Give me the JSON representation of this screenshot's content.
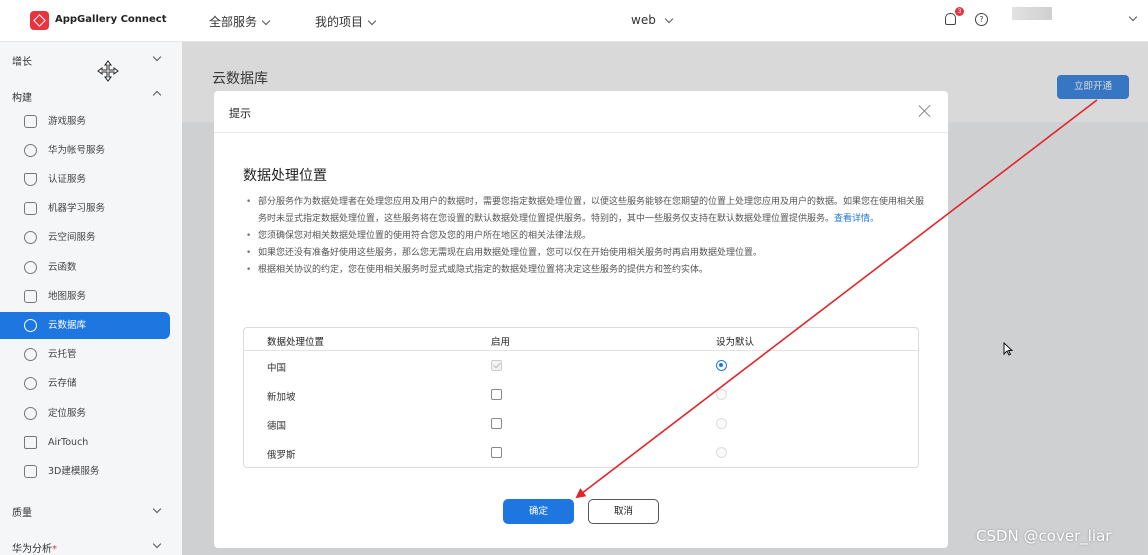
{
  "topbar": {
    "brand": "AppGallery Connect",
    "nav": [
      "全部服务",
      "我的项目"
    ],
    "project": "web",
    "bell_badge": "3",
    "help_glyph": "?"
  },
  "sidebar": {
    "sections": [
      {
        "label": "增长"
      },
      {
        "label": "构建"
      },
      {
        "label": "质量"
      },
      {
        "label": "华为分析"
      }
    ],
    "items": [
      {
        "label": "游戏服务",
        "icon": "game-icon"
      },
      {
        "label": "华为帐号服务",
        "icon": "account-icon"
      },
      {
        "label": "认证服务",
        "icon": "shield-icon"
      },
      {
        "label": "机器学习服务",
        "icon": "robot-icon"
      },
      {
        "label": "云空间服务",
        "icon": "cloud-icon"
      },
      {
        "label": "云函数",
        "icon": "function-icon"
      },
      {
        "label": "地图服务",
        "icon": "map-icon"
      },
      {
        "label": "云数据库",
        "icon": "database-icon",
        "active": true
      },
      {
        "label": "云托管",
        "icon": "hosting-icon"
      },
      {
        "label": "云存储",
        "icon": "storage-icon"
      },
      {
        "label": "定位服务",
        "icon": "location-icon"
      },
      {
        "label": "AirTouch",
        "icon": "touch-icon"
      },
      {
        "label": "3D建模服务",
        "icon": "cube-icon"
      }
    ],
    "new_marker": "*"
  },
  "main": {
    "title": "云数据库",
    "open_button": "立即开通"
  },
  "modal": {
    "title": "提示",
    "heading": "数据处理位置",
    "bullets": [
      "部分服务作为数据处理者在处理您应用及用户的数据时，需要您指定数据处理位置，以便这些服务能够在您期望的位置上处理您应用及用户的数据。如果您在使用相关服务时未显式指定数据处理位置，这些服务将在您设置的默认数据处理位置提供服务。特别的，其中一些服务仅支持在默认数据处理位置提供服务。",
      "您须确保您对相关数据处理位置的使用符合您及您的用户所在地区的相关法律法规。",
      "如果您还没有准备好使用这些服务，那么您无需现在启用数据处理位置，您可以仅在开始使用相关服务时再启用数据处理位置。",
      "根据相关协议的约定，您在使用相关服务时显式或隐式指定的数据处理位置将决定这些服务的提供方和签约实体。"
    ],
    "details_link": "查看详情。",
    "table": {
      "headers": [
        "数据处理位置",
        "启用",
        "设为默认"
      ],
      "rows": [
        {
          "location": "中国",
          "enabled": true,
          "enabled_locked": true,
          "default": true
        },
        {
          "location": "新加坡",
          "enabled": false,
          "enabled_locked": false,
          "default": false
        },
        {
          "location": "德国",
          "enabled": false,
          "enabled_locked": false,
          "default": false
        },
        {
          "location": "俄罗斯",
          "enabled": false,
          "enabled_locked": false,
          "default": false
        }
      ]
    },
    "ok_button": "确定",
    "cancel_button": "取消"
  },
  "annotation": {
    "arrow_color": "#e3232a",
    "watermark": "CSDN @cover_liar"
  }
}
